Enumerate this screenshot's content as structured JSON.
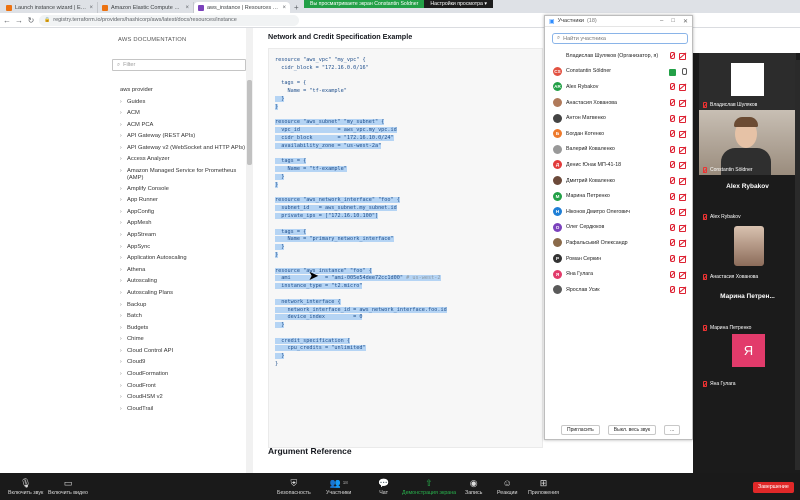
{
  "browser": {
    "tabs": [
      {
        "title": "Launch instance wizard | EC2 Ma",
        "color": "#ec7211"
      },
      {
        "title": "Amazon Elastic Compute Cloud",
        "color": "#ec7211"
      },
      {
        "title": "aws_instance | Resources | hashi",
        "color": "#7b42bc"
      },
      {
        "title": "",
        "color": ""
      }
    ],
    "url": "registry.terraform.io/providers/hashicorp/aws/latest/docs/resources/instance"
  },
  "zoom_banner": {
    "left": "Вы просматриваете экран Constantin Soldner",
    "right": "Настройки просмотра ▾"
  },
  "sidebar": {
    "heading": "AWS DOCUMENTATION",
    "filter_placeholder": "Filter",
    "items": [
      {
        "label": "aws provider",
        "chevron": false
      },
      {
        "label": "Guides",
        "chevron": true
      },
      {
        "label": "ACM",
        "chevron": true
      },
      {
        "label": "ACM PCA",
        "chevron": true
      },
      {
        "label": "API Gateway (REST APIs)",
        "chevron": true
      },
      {
        "label": "API Gateway v2 (WebSocket and HTTP APIs)",
        "chevron": true
      },
      {
        "label": "Access Analyzer",
        "chevron": true
      },
      {
        "label": "Amazon Managed Service for Prometheus (AMP)",
        "chevron": true
      },
      {
        "label": "Amplify Console",
        "chevron": true
      },
      {
        "label": "App Runner",
        "chevron": true
      },
      {
        "label": "AppConfig",
        "chevron": true
      },
      {
        "label": "AppMesh",
        "chevron": true
      },
      {
        "label": "AppStream",
        "chevron": true
      },
      {
        "label": "AppSync",
        "chevron": true
      },
      {
        "label": "Application Autoscaling",
        "chevron": true
      },
      {
        "label": "Athena",
        "chevron": true
      },
      {
        "label": "Autoscaling",
        "chevron": true
      },
      {
        "label": "Autoscaling Plans",
        "chevron": true
      },
      {
        "label": "Backup",
        "chevron": true
      },
      {
        "label": "Batch",
        "chevron": true
      },
      {
        "label": "Budgets",
        "chevron": true
      },
      {
        "label": "Chime",
        "chevron": true
      },
      {
        "label": "Cloud Control API",
        "chevron": true
      },
      {
        "label": "Cloud9",
        "chevron": true
      },
      {
        "label": "CloudFormation",
        "chevron": true
      },
      {
        "label": "CloudFront",
        "chevron": true
      },
      {
        "label": "CloudHSM v2",
        "chevron": true
      },
      {
        "label": "CloudTrail",
        "chevron": true
      }
    ]
  },
  "content": {
    "section_title": "Network and Credit Specification Example",
    "next_section_title": "Argument Reference",
    "code_lines": [
      {
        "text": "resource \"aws_vpc\" \"my_vpc\" {",
        "sel": false
      },
      {
        "text": "  cidr_block = \"172.16.0.0/16\"",
        "sel": false
      },
      {
        "text": "",
        "sel": false
      },
      {
        "text": "  tags = {",
        "sel": false
      },
      {
        "text": "    Name = \"tf-example\"",
        "sel": false
      },
      {
        "text": "  }",
        "sel": true
      },
      {
        "text": "}",
        "sel": true
      },
      {
        "text": "",
        "sel": false
      },
      {
        "text": "resource \"aws_subnet\" \"my_subnet\" {",
        "sel": true
      },
      {
        "text": "  vpc_id            = aws_vpc.my_vpc.id",
        "sel": true
      },
      {
        "text": "  cidr_block        = \"172.16.10.0/24\"",
        "sel": true
      },
      {
        "text": "  availability_zone = \"us-west-2a\"",
        "sel": true
      },
      {
        "text": "",
        "sel": true
      },
      {
        "text": "  tags = {",
        "sel": true
      },
      {
        "text": "    Name = \"tf-example\"",
        "sel": true
      },
      {
        "text": "  }",
        "sel": true
      },
      {
        "text": "}",
        "sel": true
      },
      {
        "text": "",
        "sel": false
      },
      {
        "text": "resource \"aws_network_interface\" \"foo\" {",
        "sel": true
      },
      {
        "text": "  subnet_id   = aws_subnet.my_subnet.id",
        "sel": true
      },
      {
        "text": "  private_ips = [\"172.16.10.100\"]",
        "sel": true
      },
      {
        "text": "",
        "sel": true
      },
      {
        "text": "  tags = {",
        "sel": true
      },
      {
        "text": "    Name = \"primary_network_interface\"",
        "sel": true
      },
      {
        "text": "  }",
        "sel": true
      },
      {
        "text": "}",
        "sel": true
      },
      {
        "text": "",
        "sel": false
      },
      {
        "text": "resource \"aws_instance\" \"foo\" {",
        "sel": true
      },
      {
        "text": "  ami           = \"ami-005e54dee72cc1d00\"",
        "sel": true,
        "comment": " # us-west-2"
      },
      {
        "text": "  instance_type = \"t2.micro\"",
        "sel": true
      },
      {
        "text": "",
        "sel": true
      },
      {
        "text": "  network_interface {",
        "sel": true
      },
      {
        "text": "    network_interface_id = aws_network_interface.foo.id",
        "sel": true
      },
      {
        "text": "    device_index         = 0",
        "sel": true
      },
      {
        "text": "  }",
        "sel": true
      },
      {
        "text": "",
        "sel": true
      },
      {
        "text": "  credit_specification {",
        "sel": true
      },
      {
        "text": "    cpu_credits = \"unlimited\"",
        "sel": true
      },
      {
        "text": "  }",
        "sel": true
      },
      {
        "text": "}",
        "sel": false
      }
    ]
  },
  "participants": {
    "title": "Участники",
    "count": "(18)",
    "search_placeholder": "Найти участника",
    "list": [
      {
        "name": "Владислав Шуляков (Организатор, я)",
        "initials": "",
        "color": "",
        "mic": "muted",
        "cam": "off"
      },
      {
        "name": "Constantin Söldner",
        "initials": "CS",
        "color": "#e25141",
        "mic": "on",
        "cam": "on"
      },
      {
        "name": "Alex Rybakov",
        "initials": "AR",
        "color": "#23a047",
        "mic": "muted",
        "cam": "off"
      },
      {
        "name": "Анастасия Хованова",
        "initials": "",
        "color": "#b07a5a",
        "mic": "muted",
        "cam": "off"
      },
      {
        "name": "Антон Матвенко",
        "initials": "",
        "color": "#444",
        "mic": "muted",
        "cam": "off"
      },
      {
        "name": "Богдан Котенко",
        "initials": "Б",
        "color": "#ee7a2c",
        "mic": "muted",
        "cam": "off"
      },
      {
        "name": "Валерий Коваленко",
        "initials": "",
        "color": "#999",
        "mic": "muted",
        "cam": "off"
      },
      {
        "name": "Денис Юнак МП-41-18",
        "initials": "Д",
        "color": "#e23b3b",
        "mic": "muted",
        "cam": "off"
      },
      {
        "name": "Дмитрий Коваленко",
        "initials": "",
        "color": "#6c4a3a",
        "mic": "muted",
        "cam": "off"
      },
      {
        "name": "Марина Петренко",
        "initials": "М",
        "color": "#23a047",
        "mic": "muted",
        "cam": "off"
      },
      {
        "name": "Ніконов Дмитро Олегович",
        "initials": "Н",
        "color": "#1f7fd6",
        "mic": "muted",
        "cam": "off"
      },
      {
        "name": "Олег Сердюков",
        "initials": "О",
        "color": "#7b42bc",
        "mic": "muted",
        "cam": "off"
      },
      {
        "name": "Рафальський Олександр",
        "initials": "",
        "color": "#8a6a4a",
        "mic": "muted",
        "cam": "off"
      },
      {
        "name": "Роман Серкин",
        "initials": "P",
        "color": "#333",
        "mic": "muted",
        "cam": "off"
      },
      {
        "name": "Яна Гулага",
        "initials": "Я",
        "color": "#e23b6b",
        "mic": "muted",
        "cam": "off"
      },
      {
        "name": "Ярослав Усик",
        "initials": "",
        "color": "#5a5a5a",
        "mic": "muted",
        "cam": "off"
      }
    ],
    "invite_label": "Пригласить",
    "mute_all_label": "Выкл. весь звук",
    "more_label": "..."
  },
  "video_tiles": [
    {
      "name": "Владислав Шуляков",
      "big": "",
      "bg": "#2c2c2c",
      "avatar": "white-square"
    },
    {
      "name": "Constantin Söldner",
      "big": "",
      "bg": "#8a7d70",
      "avatar": "face"
    },
    {
      "name": "Alex Rybakov",
      "big": "Alex Rybakov",
      "bg": "#1b1b1b",
      "avatar": ""
    },
    {
      "name": "Анастасия Хованова",
      "big": "",
      "bg": "#1b1b1b",
      "avatar": "photo"
    },
    {
      "name": "Марина Петренко",
      "big": "Марина Петрен...",
      "bg": "#1b1b1b",
      "avatar": ""
    },
    {
      "name": "Яна Гулага",
      "big": "",
      "bg": "#1b1b1b",
      "avatar": "Я"
    }
  ],
  "toolbar": {
    "audio": "Включить звук",
    "video": "Включить видео",
    "security": "Безопасность",
    "participants": "Участники",
    "participants_count": "18",
    "chat": "Чат",
    "share": "Демонстрация экрана",
    "record": "Запись",
    "reactions": "Реакции",
    "apps": "Приложения",
    "end": "Завершение"
  },
  "colors": {
    "zoom_green": "#23a047",
    "selection": "#b5d4f4",
    "end_red": "#e02828"
  }
}
